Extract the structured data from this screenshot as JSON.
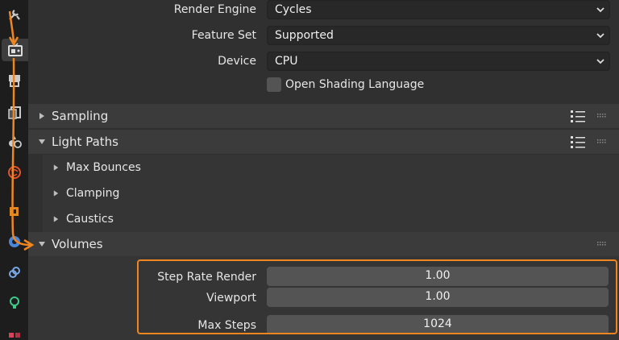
{
  "render": {
    "engine_label": "Render Engine",
    "engine_value": "Cycles",
    "feature_set_label": "Feature Set",
    "feature_set_value": "Supported",
    "device_label": "Device",
    "device_value": "CPU",
    "osl_label": "Open Shading Language"
  },
  "panels": {
    "sampling": "Sampling",
    "light_paths": "Light Paths",
    "max_bounces": "Max Bounces",
    "clamping": "Clamping",
    "caustics": "Caustics",
    "volumes": "Volumes"
  },
  "volumes": {
    "step_rate_render_label": "Step Rate Render",
    "step_rate_render_value": "1.00",
    "viewport_label": "Viewport",
    "viewport_value": "1.00",
    "max_steps_label": "Max Steps",
    "max_steps_value": "1024"
  },
  "colors": {
    "annotation": "#f0861f",
    "tab_strip": "#1d1d1d",
    "panel_bg": "#303030"
  },
  "tab_icons": [
    "tool-icon",
    "render-icon",
    "output-icon",
    "view-layer-icon",
    "scene-icon",
    "world-icon",
    "object-icon",
    "modifier-icon",
    "particles-icon",
    "physics-icon",
    "constraints-icon",
    "data-icon"
  ]
}
